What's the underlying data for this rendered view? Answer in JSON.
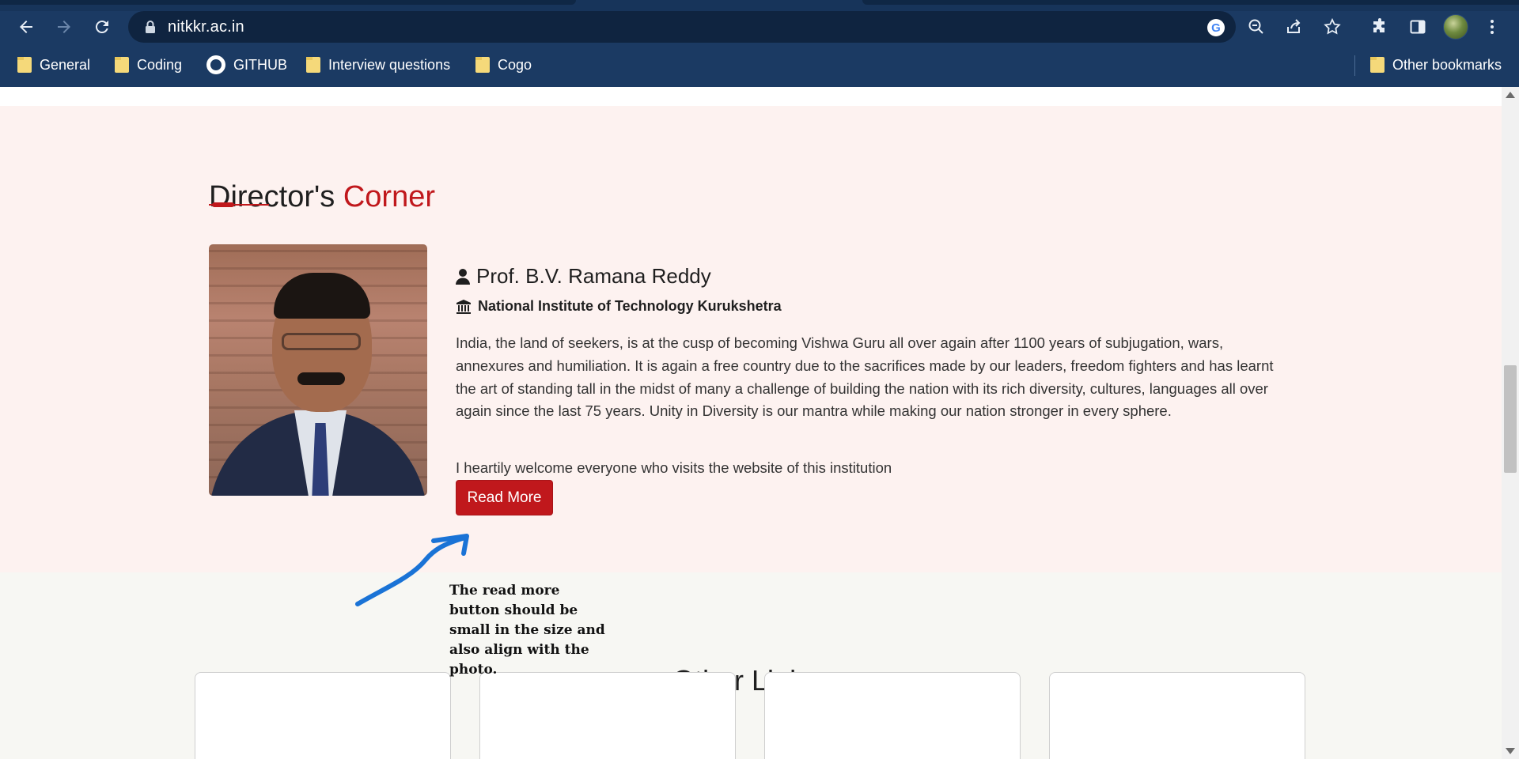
{
  "browser": {
    "url": "nitkkr.ac.in",
    "bookmarks": [
      {
        "label": "General",
        "icon": "folder-icon"
      },
      {
        "label": "Coding",
        "icon": "folder-icon"
      },
      {
        "label": "GITHUB",
        "icon": "github-icon"
      },
      {
        "label": "Interview questions",
        "icon": "folder-icon"
      },
      {
        "label": "Cogo",
        "icon": "folder-icon"
      }
    ],
    "other_bookmarks": "Other bookmarks"
  },
  "directors_corner": {
    "title_main": "Director's",
    "title_accent": "Corner",
    "name": "Prof. B.V. Ramana Reddy",
    "institute": "National Institute of Technology Kurukshetra",
    "paragraph1": "India, the land of seekers, is at the cusp of becoming Vishwa Guru all over again after 1100 years of subjugation, wars, annexures and humiliation. It is again a free country due to the sacrifices made by our leaders, freedom fighters and has learnt the art of standing tall in the midst of many a challenge of building the nation with its rich diversity, cultures, languages all over again since the last 75 years. Unity in Diversity is our mantra while making our nation stronger in every sphere.",
    "paragraph2": "I heartily welcome everyone who visits the website of this institution",
    "read_more": "Read More"
  },
  "annotation": {
    "note": "The read more button should be small in the size and also align with the photo."
  },
  "other_links": {
    "title": "Other Links"
  },
  "colors": {
    "accent": "#c0181c",
    "chrome": "#1b3a63",
    "section_bg": "#fdf2f0",
    "annotation_arrow": "#1a73d6"
  }
}
